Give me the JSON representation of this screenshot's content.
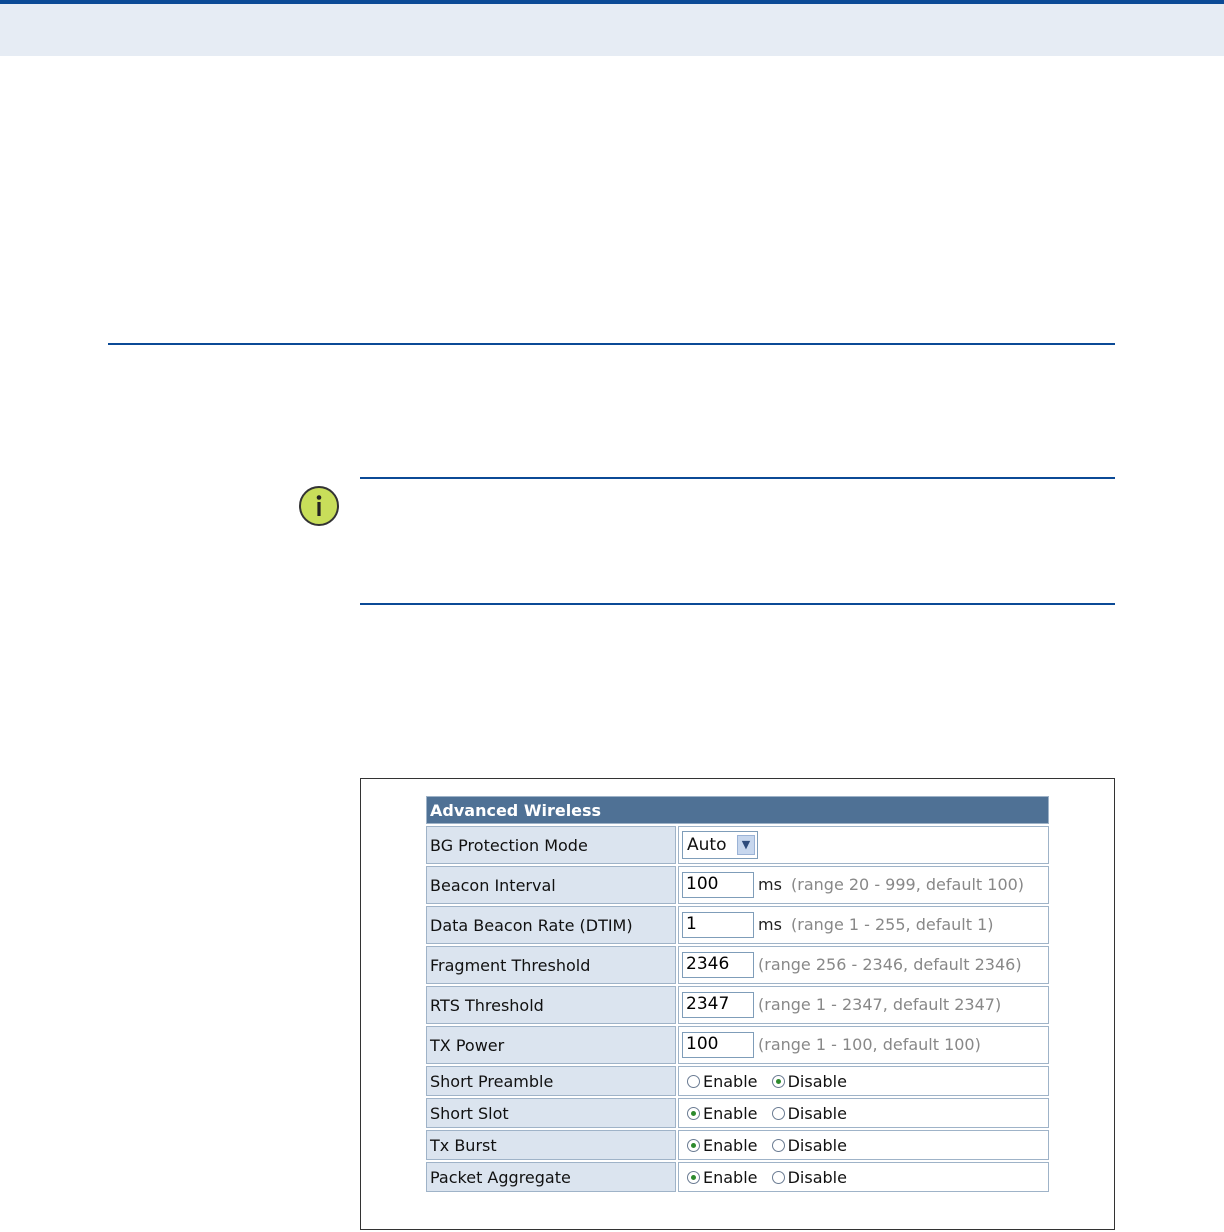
{
  "panel": {
    "title": "Advanced Wireless",
    "bg_protection": {
      "label": "BG Protection Mode",
      "value": "Auto"
    },
    "beacon_interval": {
      "label": "Beacon Interval",
      "value": "100",
      "unit": "ms",
      "hint": "(range 20 - 999, default 100)"
    },
    "dtim": {
      "label": "Data Beacon Rate (DTIM)",
      "value": "1",
      "unit": "ms",
      "hint": "(range 1 - 255, default 1)"
    },
    "fragment": {
      "label": "Fragment Threshold",
      "value": "2346",
      "hint": "(range 256 - 2346, default 2346)"
    },
    "rts": {
      "label": "RTS Threshold",
      "value": "2347",
      "hint": "(range 1 - 2347, default 2347)"
    },
    "tx_power": {
      "label": "TX Power",
      "value": "100",
      "hint": "(range 1 - 100, default 100)"
    },
    "short_preamble": {
      "label": "Short Preamble",
      "enable": "Enable",
      "disable": "Disable",
      "selected": "Disable"
    },
    "short_slot": {
      "label": "Short Slot",
      "enable": "Enable",
      "disable": "Disable",
      "selected": "Enable"
    },
    "tx_burst": {
      "label": "Tx Burst",
      "enable": "Enable",
      "disable": "Disable",
      "selected": "Enable"
    },
    "packet_aggregate": {
      "label": "Packet Aggregate",
      "enable": "Enable",
      "disable": "Disable",
      "selected": "Enable"
    }
  },
  "note": {
    "icon": "info-icon"
  },
  "colors": {
    "rule": "#0b4a96",
    "header_bg": "#4f7195",
    "label_bg": "#dbe4ef",
    "radio_on": "#2d8a2d"
  }
}
